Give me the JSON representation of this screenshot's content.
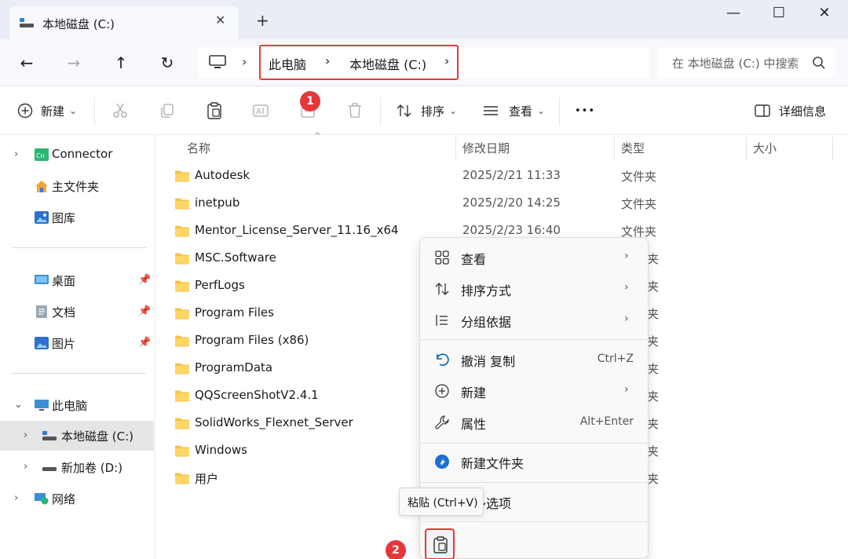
{
  "window": {
    "tab_title": "本地磁盘 (C:)",
    "tab_close_glyph": "✕",
    "new_tab_glyph": "+",
    "minimize_glyph": "—",
    "maximize_glyph": "☐",
    "close_glyph": "✕"
  },
  "addressbar": {
    "back_glyph": "←",
    "forward_glyph": "→",
    "up_glyph": "↑",
    "refresh_glyph": "↻",
    "separator_glyph": "›",
    "crumbs": [
      "此电脑",
      "本地磁盘 (C:)"
    ],
    "search_placeholder": "在 本地磁盘 (C:) 中搜索"
  },
  "toolbar": {
    "new_label": "新建",
    "sort_label": "排序",
    "view_label": "查看",
    "more_glyph": "•••",
    "details_label": "详细信息",
    "dropdown_glyph": "⌄",
    "badge_1": "1"
  },
  "sidebar": {
    "chevron_right": "›",
    "chevron_down": "⌄",
    "pin_glyph": "📌",
    "items": [
      {
        "label": "Connector",
        "icon": "connector-icon"
      },
      {
        "label": "主文件夹",
        "icon": "home-icon"
      },
      {
        "label": "图库",
        "icon": "gallery-icon"
      },
      {
        "label": "桌面",
        "icon": "desktop-icon"
      },
      {
        "label": "文档",
        "icon": "document-icon"
      },
      {
        "label": "图片",
        "icon": "picture-icon"
      },
      {
        "label": "此电脑",
        "icon": "computer-icon"
      },
      {
        "label": "本地磁盘 (C:)",
        "icon": "drive-icon"
      },
      {
        "label": "新加卷 (D:)",
        "icon": "drive-icon"
      },
      {
        "label": "网络",
        "icon": "network-icon"
      }
    ]
  },
  "columns": {
    "name": "名称",
    "modified": "修改日期",
    "type": "类型",
    "size": "大小",
    "sort_glyph": "^"
  },
  "files": [
    {
      "name": "Autodesk",
      "date": "2025/2/21 11:33",
      "type": "文件夹"
    },
    {
      "name": "inetpub",
      "date": "2025/2/20 14:25",
      "type": "文件夹"
    },
    {
      "name": "Mentor_License_Server_11.16_x64",
      "date": "2025/2/23 16:40",
      "type": "文件夹"
    },
    {
      "name": "MSC.Software",
      "date": "",
      "type": "夹"
    },
    {
      "name": "PerfLogs",
      "date": "",
      "type": "夹"
    },
    {
      "name": "Program Files",
      "date": "",
      "type": "夹"
    },
    {
      "name": "Program Files (x86)",
      "date": "",
      "type": "夹"
    },
    {
      "name": "ProgramData",
      "date": "",
      "type": "夹"
    },
    {
      "name": "QQScreenShotV2.4.1",
      "date": "",
      "type": "夹"
    },
    {
      "name": "SolidWorks_Flexnet_Server",
      "date": "",
      "type": "夹"
    },
    {
      "name": "Windows",
      "date": "",
      "type": "夹"
    },
    {
      "name": "用户",
      "date": "",
      "type": "夹"
    }
  ],
  "context_menu": {
    "arrow_glyph": "›",
    "items": [
      {
        "label": "查看",
        "shortcut": ""
      },
      {
        "label": "排序方式",
        "shortcut": ""
      },
      {
        "label": "分组依据",
        "shortcut": ""
      },
      {
        "label": "撤消 复制",
        "shortcut": "Ctrl+Z"
      },
      {
        "label": "新建",
        "shortcut": ""
      },
      {
        "label": "属性",
        "shortcut": "Alt+Enter"
      },
      {
        "label": "新建文件夹",
        "shortcut": ""
      },
      {
        "label": "更多选项",
        "shortcut": ""
      }
    ],
    "tooltip": "粘贴 (Ctrl+V)",
    "badge_2": "2"
  },
  "colors": {
    "accent": "#0067c0",
    "folder": "#f6c343",
    "highlight_red": "#e03c3c",
    "badge_red": "#e6373a"
  }
}
